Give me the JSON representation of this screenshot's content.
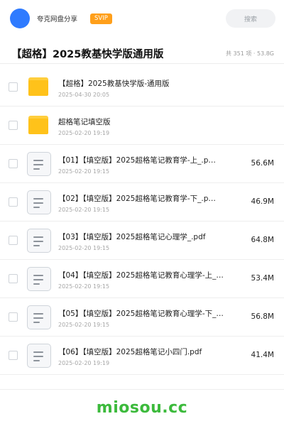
{
  "header": {
    "user_name": "夸克网盘分享",
    "badge": "SVIP",
    "search_placeholder": "搜索"
  },
  "share": {
    "title": "【超格】2025教基快学版通用版",
    "meta": "共 351 项 · 53.8G"
  },
  "files": [
    {
      "type": "folder",
      "name": "【超格】2025教基快学版-通用版",
      "date": "2025-04-30 20:05",
      "size": ""
    },
    {
      "type": "folder",
      "name": "超格笔记填空版",
      "date": "2025-02-20 19:19",
      "size": ""
    },
    {
      "type": "doc",
      "name": "【01】【填空版】2025超格笔记教育学-上_.p…",
      "date": "2025-02-20 19:15",
      "size": "56.6M"
    },
    {
      "type": "doc",
      "name": "【02】【填空版】2025超格笔记教育学-下_.p…",
      "date": "2025-02-20 19:15",
      "size": "46.9M"
    },
    {
      "type": "doc",
      "name": "【03】【填空版】2025超格笔记心理学_.pdf",
      "date": "2025-02-20 19:15",
      "size": "64.8M"
    },
    {
      "type": "doc",
      "name": "【04】【填空版】2025超格笔记教育心理学-上_…",
      "date": "2025-02-20 19:15",
      "size": "53.4M"
    },
    {
      "type": "doc",
      "name": "【05】【填空版】2025超格笔记教育心理学-下_…",
      "date": "2025-02-20 19:15",
      "size": "56.8M"
    },
    {
      "type": "doc",
      "name": "【06】【填空版】2025超格笔记小四门.pdf",
      "date": "2025-02-20 19:19",
      "size": "41.4M"
    }
  ],
  "footer": {
    "watermark": "miosou.cc"
  },
  "colors": {
    "avatar": "#2f7bff",
    "badge": "#ff9f1a",
    "folder": "#ffc21a",
    "watermark": "#3cba3c"
  }
}
